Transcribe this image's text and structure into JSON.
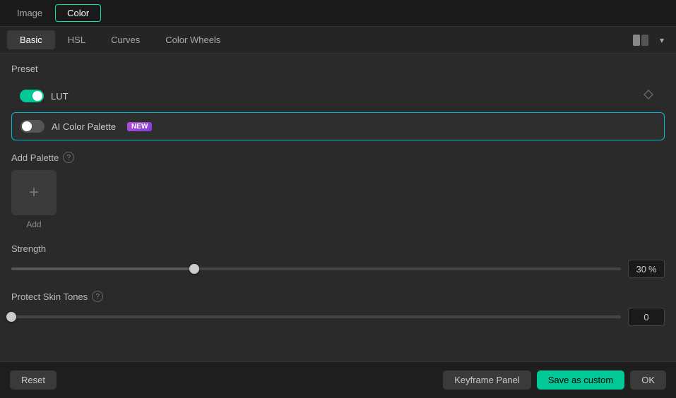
{
  "top_tabs": {
    "items": [
      {
        "id": "image",
        "label": "Image",
        "active": false
      },
      {
        "id": "color",
        "label": "Color",
        "active": true
      }
    ]
  },
  "sec_tabs": {
    "items": [
      {
        "id": "basic",
        "label": "Basic",
        "active": true
      },
      {
        "id": "hsl",
        "label": "HSL",
        "active": false
      },
      {
        "id": "curves",
        "label": "Curves",
        "active": false
      },
      {
        "id": "color-wheels",
        "label": "Color Wheels",
        "active": false
      }
    ]
  },
  "preset": {
    "label": "Preset",
    "lut": {
      "label": "LUT",
      "enabled": true
    },
    "ai_color_palette": {
      "label": "AI Color Palette",
      "badge": "NEW",
      "enabled": false
    }
  },
  "add_palette": {
    "label": "Add Palette",
    "info_title": "info",
    "add_item": {
      "symbol": "+",
      "label": "Add"
    }
  },
  "strength": {
    "label": "Strength",
    "value": 30,
    "unit": "%",
    "percent": 30
  },
  "protect_skin_tones": {
    "label": "Protect Skin Tones",
    "info_title": "info",
    "value": 0,
    "percent": 0
  },
  "bottom_bar": {
    "reset_label": "Reset",
    "keyframe_label": "Keyframe Panel",
    "save_custom_label": "Save as custom",
    "ok_label": "OK"
  },
  "colors": {
    "accent": "#00c896",
    "accent_border": "#00bcd4",
    "badge_gradient_start": "#b04fd8",
    "badge_gradient_end": "#7c3fd8"
  }
}
